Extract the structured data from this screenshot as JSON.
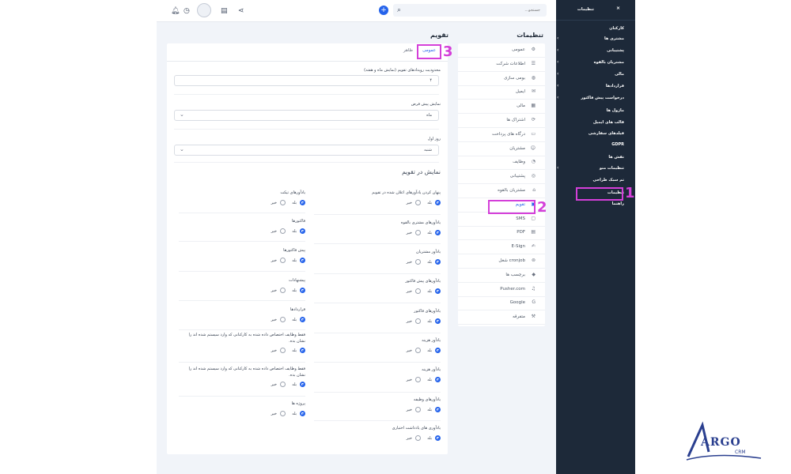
{
  "search": {
    "placeholder": "جستجو..."
  },
  "topbar": {
    "plus": "+"
  },
  "sidebar": {
    "title": "تنظیمات",
    "close": "×",
    "items": [
      {
        "label": "کارکنان",
        "chevron": false
      },
      {
        "label": "مشتری ها",
        "chevron": true
      },
      {
        "label": "پشتیبانی",
        "chevron": true
      },
      {
        "label": "مشتریان بالقوه",
        "chevron": true
      },
      {
        "label": "مالی",
        "chevron": true
      },
      {
        "label": "قراردادها",
        "chevron": true
      },
      {
        "label": "درخواست پیش فاکتور",
        "chevron": true
      },
      {
        "label": "ماژول ها",
        "chevron": false
      },
      {
        "label": "قالب های ایمیل",
        "chevron": false
      },
      {
        "label": "فیلدهای سفارشی",
        "chevron": false
      },
      {
        "label": "GDPR",
        "chevron": false
      },
      {
        "label": "نقش ها",
        "chevron": false
      },
      {
        "label": "تنظیمات منو",
        "chevron": true
      },
      {
        "label": "تم سبک طراحی",
        "chevron": false
      },
      {
        "label": "تنظیمات",
        "chevron": false
      },
      {
        "label": "راهنما",
        "chevron": false
      }
    ]
  },
  "settings_menu": {
    "title": "تنظیمات",
    "items": [
      {
        "label": "عمومی",
        "icon": "⚙"
      },
      {
        "label": "اطلاعات شرکت",
        "icon": "☰"
      },
      {
        "label": "بومی سازی",
        "icon": "◍"
      },
      {
        "label": "ایمیل",
        "icon": "✉"
      },
      {
        "label": "مالی",
        "icon": "▦"
      },
      {
        "label": "اشتراک ها",
        "icon": "⟳"
      },
      {
        "label": "درگاه های پرداخت",
        "icon": "▭"
      },
      {
        "label": "مشتریان",
        "icon": "☺"
      },
      {
        "label": "وظایف",
        "icon": "◔"
      },
      {
        "label": "پشتیبانی",
        "icon": "◎"
      },
      {
        "label": "مشتریان بالقوه",
        "icon": "⌂"
      },
      {
        "label": "تقویم",
        "icon": "▣"
      },
      {
        "label": "SMS",
        "icon": "▢"
      },
      {
        "label": "PDF",
        "icon": "▤"
      },
      {
        "label": "E-Sign",
        "icon": "✍"
      },
      {
        "label": "cronjob شغل",
        "icon": "⊚"
      },
      {
        "label": "برچسب ها",
        "icon": "◆"
      },
      {
        "label": "Pusher.com",
        "icon": "♫"
      },
      {
        "label": "Google",
        "icon": "G"
      },
      {
        "label": "متفرقه",
        "icon": "⚒"
      }
    ]
  },
  "main": {
    "title": "تقویم",
    "tabs": {
      "general": "عمومی",
      "appearance": "ظاهر"
    },
    "fields": {
      "limit_label": "محدودیت رویدادهای تقویم (نمایش ماه و هفته)",
      "limit_value": "۴",
      "default_view_label": "نمایش پیش فرض",
      "default_view_value": "ماه",
      "first_day_label": "روز اول",
      "first_day_value": "شنبه"
    },
    "section_heading": "نمایش در تقویم",
    "yes": "بله",
    "no": "خیر",
    "right_options": [
      {
        "title": "پنهان کردن یادآورهای اعلان شده در تقویم",
        "value": "yes"
      },
      {
        "title": "یادآورهای مشتری بالقوه",
        "value": "yes"
      },
      {
        "title": "یادآور مشتریان",
        "value": "yes"
      },
      {
        "title": "یادآورهای پیش فاکتور",
        "value": "yes"
      },
      {
        "title": "یادآورهای فاکتور",
        "value": "yes"
      },
      {
        "title": "یادآور هزینه",
        "value": "yes"
      },
      {
        "title": "یادآور هزینه",
        "value": "yes"
      },
      {
        "title": "یادآورهای وظیفه",
        "value": "yes"
      },
      {
        "title": "یادآوری های یادداشت اختیاری",
        "value": "yes"
      }
    ],
    "left_options": [
      {
        "title": "یادآورهای تیکت",
        "value": "yes"
      },
      {
        "title": "فاکتورها",
        "value": "yes"
      },
      {
        "title": "پیش فاکتورها",
        "value": "yes"
      },
      {
        "title": "پیشنهادات",
        "value": "yes"
      },
      {
        "title": "قراردادها",
        "value": "yes"
      },
      {
        "title": "فقط وظایف اختصاص داده شده به کارکنانی که وارد سیستم شده اند را نشان بده.",
        "value": "yes"
      },
      {
        "title": "فقط وظایف اختصاص داده شده به کارکنانی که وارد سیستم شده اند را نشان بده.",
        "value": "yes"
      },
      {
        "title": "پروژه ها",
        "value": "yes"
      }
    ]
  },
  "annotations": {
    "one": "1",
    "two": "2",
    "three": "3"
  },
  "logo": {
    "text": "ARGO",
    "sub": "CRM"
  },
  "colors": {
    "accent": "#2563eb",
    "sidebar": "#1d2939",
    "highlight": "#d43fd9"
  }
}
